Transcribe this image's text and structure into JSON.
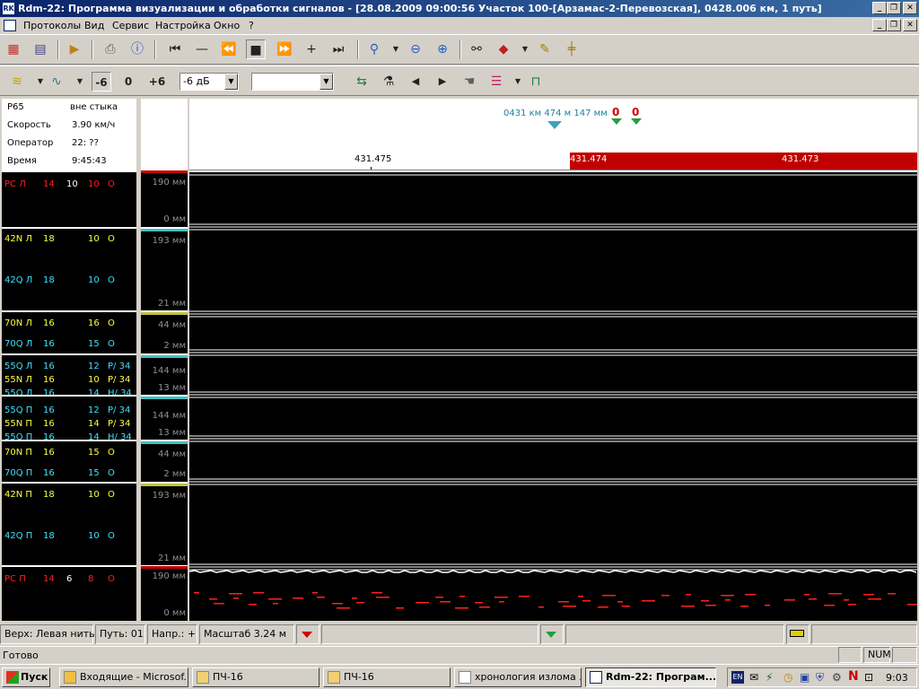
{
  "window": {
    "title": "Rdm-22: Программа визуализации и обработки сигналов - [28.08.2009 09:00:56 Участок 100-[Арзамас-2-Перевозская], 0428.006 км, 1 путь]"
  },
  "menu": [
    "Протоколы",
    "Вид",
    "Сервис",
    "Настройка",
    "Окно",
    "?"
  ],
  "toolbar2": {
    "minus6": "-6",
    "zero": "0",
    "plus6": "+6",
    "gain": "-6 дБ",
    "combo2": ""
  },
  "info": {
    "p65": "Р65",
    "joint": "вне стыка",
    "speed_label": "Скорость",
    "speed": "3.90 км/ч",
    "operator_label": "Оператор",
    "operator": "22: ??",
    "time_label": "Время",
    "time": "9:45:43"
  },
  "ruler": {
    "marker": "0431 км 474 м 147 мм",
    "km1": "431.475",
    "km2": "431.474",
    "km3": "431.473",
    "flag1": "0",
    "flag2": "0"
  },
  "channels": [
    {
      "name": "РС Л",
      "a": "14",
      "b": "10",
      "c": "10",
      "d": "О",
      "color": "#ff2020"
    },
    {
      "name": "42N Л",
      "a": "18",
      "b": "",
      "c": "10",
      "d": "О",
      "color": "#ffff40"
    },
    {
      "name": "42Q Л",
      "a": "18",
      "b": "",
      "c": "10",
      "d": "О",
      "color": "#40e0ff"
    },
    {
      "name": "70N Л",
      "a": "16",
      "b": "",
      "c": "16",
      "d": "О",
      "color": "#ffff40"
    },
    {
      "name": "70Q Л",
      "a": "16",
      "b": "",
      "c": "15",
      "d": "О",
      "color": "#40e0ff"
    },
    {
      "name": "55Q Л",
      "a": "16",
      "b": "",
      "c": "12",
      "d": "Р/ 34",
      "color": "#40e0ff"
    },
    {
      "name": "55N Л",
      "a": "16",
      "b": "",
      "c": "10",
      "d": "Р/ 34",
      "color": "#ffff40"
    },
    {
      "name": "55Q Л",
      "a": "16",
      "b": "",
      "c": "14",
      "d": "Н/ 34",
      "color": "#40e0ff"
    },
    {
      "name": "55Q П",
      "a": "16",
      "b": "",
      "c": "12",
      "d": "Р/ 34",
      "color": "#40e0ff"
    },
    {
      "name": "55N П",
      "a": "16",
      "b": "",
      "c": "14",
      "d": "Р/ 34",
      "color": "#ffff40"
    },
    {
      "name": "55Q П",
      "a": "16",
      "b": "",
      "c": "14",
      "d": "Н/ 34",
      "color": "#40e0ff"
    },
    {
      "name": "70N П",
      "a": "16",
      "b": "",
      "c": "15",
      "d": "О",
      "color": "#ffff40"
    },
    {
      "name": "70Q П",
      "a": "16",
      "b": "",
      "c": "15",
      "d": "О",
      "color": "#40e0ff"
    },
    {
      "name": "42N П",
      "a": "18",
      "b": "",
      "c": "10",
      "d": "О",
      "color": "#ffff40"
    },
    {
      "name": "42Q П",
      "a": "18",
      "b": "",
      "c": "10",
      "d": "О",
      "color": "#40e0ff"
    },
    {
      "name": "РС П",
      "a": "14",
      "b": "6",
      "c": "8",
      "d": "О",
      "color": "#ff2020"
    }
  ],
  "scales": [
    "190 мм",
    "0 мм",
    "193 мм",
    "21 мм",
    "44 мм",
    "2 мм",
    "144 мм",
    "13 мм",
    "144 мм",
    "13 мм",
    "44 мм",
    "2 мм",
    "193 мм",
    "21 мм",
    "190 мм",
    "0 мм"
  ],
  "status": {
    "rail": "Верх: Левая нить",
    "path": "Путь:  01",
    "dir": "Напр.: +",
    "scale": "Масштаб    3.24 м",
    "ready": "Готово",
    "num": "NUM"
  },
  "taskbar": {
    "start": "Пуск",
    "tasks": [
      "Входящие - Microsof...",
      "ПЧ-16",
      "ПЧ-16",
      "хронология излома ...",
      "Rdm-22: Програм..."
    ],
    "lang": "EN",
    "clock": "9:03"
  }
}
